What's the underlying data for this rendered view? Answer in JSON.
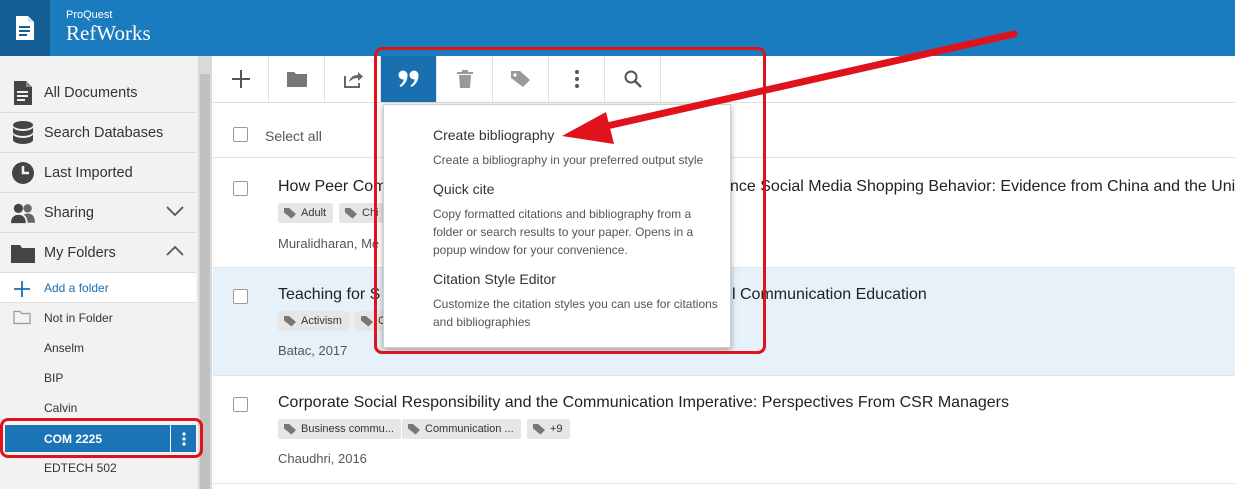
{
  "header": {
    "brand_small": "ProQuest",
    "brand_big": "RefWorks"
  },
  "sidebar": {
    "items": [
      {
        "label": "All Documents",
        "icon": "document-icon"
      },
      {
        "label": "Search Databases",
        "icon": "database-icon"
      },
      {
        "label": "Last Imported",
        "icon": "clock-icon"
      },
      {
        "label": "Sharing",
        "icon": "users-icon"
      },
      {
        "label": "My Folders",
        "icon": "folder-icon"
      }
    ],
    "add_folder": "Add a folder",
    "folders": [
      "Not in Folder",
      "Anselm",
      "BIP",
      "Calvin",
      "COM 2225",
      "EDTECH 502"
    ]
  },
  "content": {
    "select_all": "Select all",
    "rows": [
      {
        "title": "How Peer Com",
        "title_end": "nce Social Media Shopping Behavior: Evidence from China and the Unit",
        "tags": [
          "Adult",
          "Chi"
        ],
        "meta": "Muralidharan, Me"
      },
      {
        "title": "Teaching for S",
        "title_end": "l Communication Education",
        "tags": [
          "Activism",
          "C"
        ],
        "meta": "Batac, 2017"
      },
      {
        "title": "Corporate Social Responsibility and the Communication Imperative: Perspectives From CSR Managers",
        "tags": [
          "Business commu...",
          "Communication ...",
          "+9"
        ],
        "meta": "Chaudhri, 2016"
      }
    ]
  },
  "dropdown": {
    "items": [
      {
        "heading": "Create bibliography",
        "desc": "Create a bibliography in your preferred output style"
      },
      {
        "heading": "Quick cite",
        "desc": "Copy formatted citations and bibliography from a folder or search results to your paper. Opens in a popup window for your convenience."
      },
      {
        "heading": "Citation Style Editor",
        "desc": "Customize the citation styles you can use for citations and bibliographies"
      }
    ]
  },
  "colors": {
    "header_blue": "#1a7cbf",
    "selected_blue": "#1a74b5",
    "annotation_red": "#e0121b"
  }
}
